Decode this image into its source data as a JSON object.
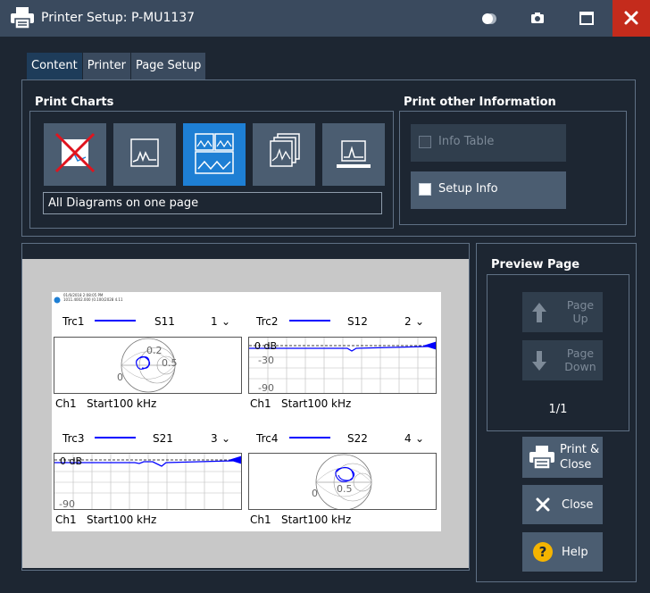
{
  "window": {
    "title": "Printer Setup: P-MU1137"
  },
  "tabs": [
    {
      "label": "Content",
      "active": true
    },
    {
      "label": "Printer",
      "active": false
    },
    {
      "label": "Page Setup",
      "active": false
    }
  ],
  "print_charts": {
    "label": "Print Charts",
    "options": [
      "no-diagram-icon",
      "active-diagram-icon",
      "all-diagrams-one-page-icon",
      "all-diagrams-separate-pages-icon",
      "diagram-marker-icon"
    ],
    "selected_index": 2,
    "mode_text": "All Diagrams on one page"
  },
  "other_info": {
    "label": "Print other Information",
    "info_table": {
      "label": "Info Table",
      "checked": false,
      "enabled": false
    },
    "setup_info": {
      "label": "Setup Info",
      "checked": false,
      "enabled": true
    }
  },
  "preview": {
    "header_line1": "01/6/2018 2:08:05 PM",
    "header_line2": "1011.4002.000 (0.100/2028 4.11",
    "charts": [
      {
        "trace": "Trc1",
        "param": "S11",
        "num": "1",
        "footer_ch": "Ch1",
        "footer_start": "Start100 kHz",
        "labels": [
          "0.2",
          "0.5",
          "0"
        ]
      },
      {
        "trace": "Trc2",
        "param": "S12",
        "num": "2",
        "footer_ch": "Ch1",
        "footer_start": "Start100 kHz",
        "labels": [
          "0 dB",
          "-30",
          "-90"
        ]
      },
      {
        "trace": "Trc3",
        "param": "S21",
        "num": "3",
        "footer_ch": "Ch1",
        "footer_start": "Start100 kHz",
        "labels": [
          "0 dB",
          "-90"
        ]
      },
      {
        "trace": "Trc4",
        "param": "S22",
        "num": "4",
        "footer_ch": "Ch1",
        "footer_start": "Start100 kHz",
        "labels": [
          "0.5",
          "0"
        ]
      }
    ]
  },
  "preview_page": {
    "label": "Preview Page",
    "page_up": {
      "line1": "Page",
      "line2": "Up"
    },
    "page_down": {
      "line1": "Page",
      "line2": "Down"
    },
    "counter": "1/1"
  },
  "actions": {
    "print_close": {
      "line1": "Print &",
      "line2": "Close"
    },
    "close": "Close",
    "help": "Help"
  },
  "colors": {
    "accent": "#1e7fd4",
    "trace": "#0000ff",
    "close_red": "#c42b1c",
    "background": "#1d2632"
  }
}
